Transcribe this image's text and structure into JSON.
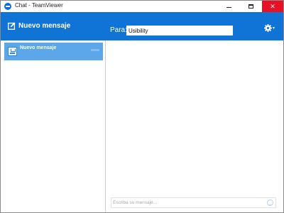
{
  "window": {
    "title": "Chat - TeamViewer",
    "minimize_icon": "minimize-icon",
    "maximize_icon": "maximize-icon",
    "close_icon": "close-icon",
    "close_glyph": "✕"
  },
  "header": {
    "new_message_label": "Nuevo mensaje",
    "new_message_icon": "compose-icon",
    "to_label": "Para:",
    "to_value": "Usibility",
    "settings_icon": "gear-icon",
    "settings_caret": "▾",
    "brand_color": "#1073d6"
  },
  "sidebar": {
    "items": [
      {
        "label": "Nuevo mensaje",
        "icon": "group-avatar-icon",
        "selected": true,
        "selected_color": "#5ba7e9"
      }
    ]
  },
  "compose": {
    "placeholder": "Escriba su mensaje...",
    "value": "",
    "emoji_icon": "emoji-icon"
  }
}
